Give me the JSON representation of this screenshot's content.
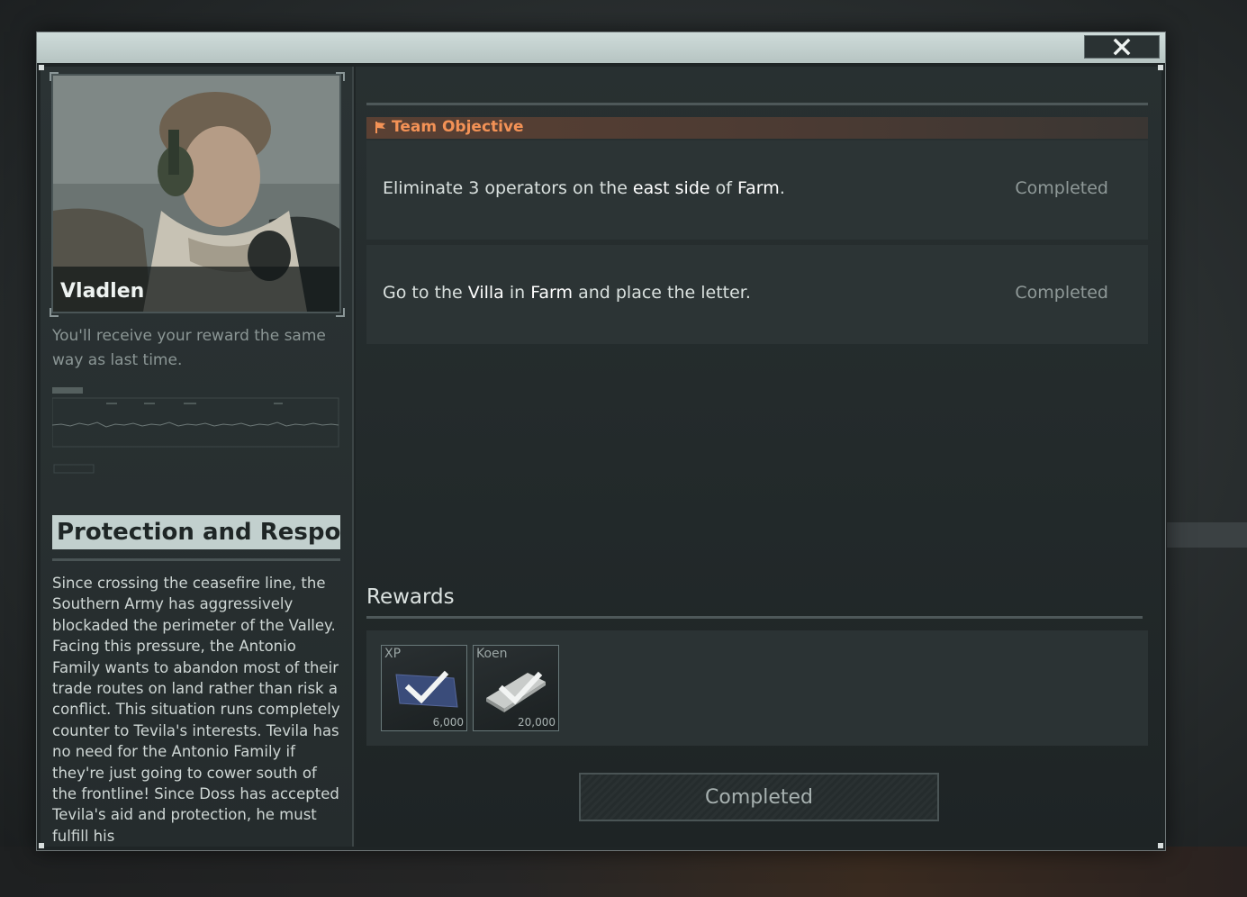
{
  "window": {
    "close_icon": "close-icon"
  },
  "trader": {
    "name": "Vladlen",
    "hint": "You'll receive your reward the same way as last time."
  },
  "mission": {
    "title": "Protection and Respon...",
    "description": "Since crossing the ceasefire line, the Southern Army has aggressively blockaded the perimeter of the Valley. Facing this pressure, the Antonio Family wants to abandon most of their trade routes on land rather than risk a conflict. This situation runs completely counter to Tevila's interests. Tevila has no need for the Antonio Family if they're just going to cower south of the frontline! Since Doss has accepted Tevila's aid and protection, he must fulfill his"
  },
  "objectives": {
    "header": "Team Objective",
    "items": [
      {
        "t1": "Eliminate 3 operators on the ",
        "h1": "east side",
        "t2": " of ",
        "h2": "Farm",
        "t3": ".",
        "t4": "",
        "status": "Completed"
      },
      {
        "t1": "Go to the ",
        "h1": "Villa",
        "t2": " in ",
        "h2": "Farm",
        "t3": " and place the letter.",
        "t4": "",
        "status": "Completed"
      }
    ]
  },
  "rewards": {
    "title": "Rewards",
    "items": [
      {
        "name": "XP",
        "qty": "6,000",
        "icon": "exp-ticket-icon"
      },
      {
        "name": "Koen",
        "qty": "20,000",
        "icon": "cash-bundle-icon"
      }
    ]
  },
  "complete_button": {
    "label": "Completed"
  },
  "colors": {
    "accent": "#f39256",
    "panel": "#1f2526",
    "title_bar": "#c2d0ce"
  }
}
